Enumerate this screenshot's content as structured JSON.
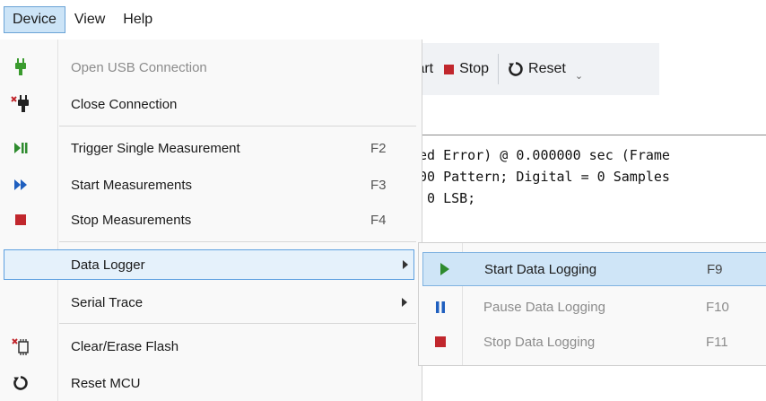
{
  "menubar": {
    "device": "Device",
    "view": "View",
    "help": "Help"
  },
  "toolbar": {
    "start": "tart",
    "stop": "Stop",
    "reset": "Reset",
    "overflow": "⌄"
  },
  "console": {
    "lines": [
      "ed Error) @ 0.000000 sec (Frame",
      "00 Pattern; Digital = 0 Samples",
      " 0 LSB;"
    ]
  },
  "device_menu": {
    "open_usb": {
      "label": "Open USB Connection",
      "icon": "usb-plug-icon"
    },
    "close_conn": {
      "label": "Close Connection",
      "icon": "usb-disconnect-icon"
    },
    "trigger": {
      "label": "Trigger Single Measurement",
      "shortcut": "F2",
      "icon": "play-pause-icon"
    },
    "start": {
      "label": "Start Measurements",
      "shortcut": "F3",
      "icon": "fast-forward-icon"
    },
    "stop": {
      "label": "Stop Measurements",
      "shortcut": "F4",
      "icon": "stop-icon"
    },
    "data_logger": {
      "label": "Data Logger"
    },
    "serial_trace": {
      "label": "Serial Trace"
    },
    "clear_flash": {
      "label": "Clear/Erase Flash",
      "icon": "erase-flash-icon"
    },
    "reset_mcu": {
      "label": "Reset MCU",
      "icon": "reset-icon"
    }
  },
  "logger_menu": {
    "start": {
      "label": "Start Data Logging",
      "shortcut": "F9",
      "icon": "play-icon"
    },
    "pause": {
      "label": "Pause Data Logging",
      "shortcut": "F10",
      "icon": "pause-icon"
    },
    "stop": {
      "label": "Stop Data Logging",
      "shortcut": "F11",
      "icon": "stop-icon"
    }
  },
  "colors": {
    "green": "#2e8b2e",
    "blue": "#1f5fbf",
    "red": "#c1272d",
    "highlight": "#cce4f7"
  }
}
